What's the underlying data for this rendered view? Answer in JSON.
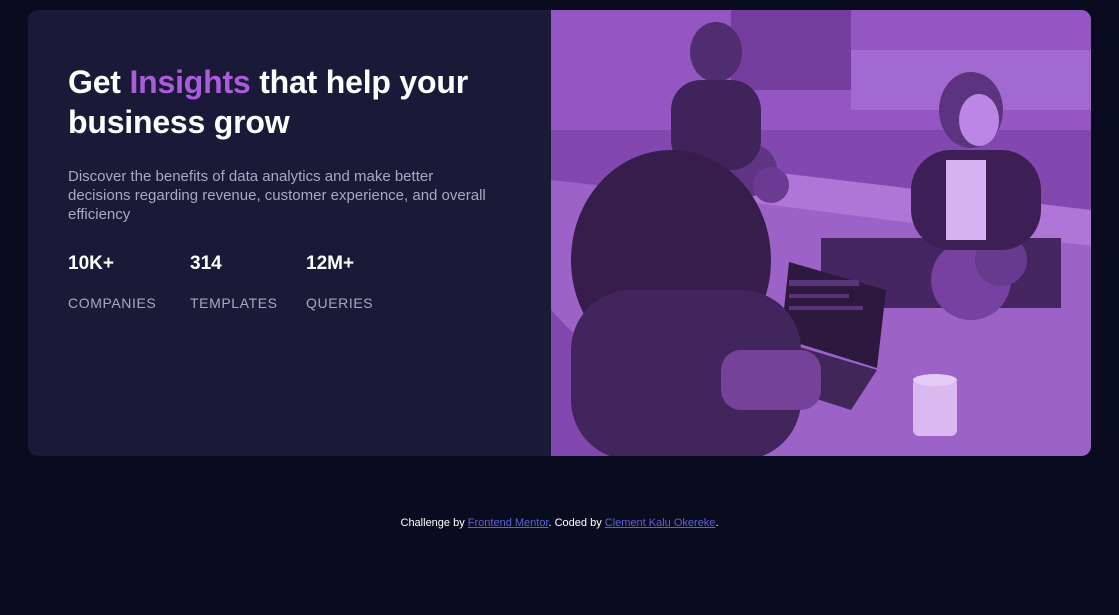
{
  "hero": {
    "headline_prefix": "Get ",
    "headline_accent": "Insights",
    "headline_suffix": " that help your business grow",
    "description": "Discover the benefits of data analytics and make better decisions regarding revenue, customer experience, and overall efficiency"
  },
  "stats": [
    {
      "value": "10K+",
      "label": "COMPANIES"
    },
    {
      "value": "314",
      "label": "TEMPLATES"
    },
    {
      "value": "12M+",
      "label": "QUERIES"
    }
  ],
  "footer": {
    "prefix": "Challenge by ",
    "link1": "Frontend Mentor",
    "middle": ". Coded by ",
    "link2": "Clement Kalu Okereke",
    "suffix": "."
  },
  "colors": {
    "page_background": "#090c1f",
    "card_background": "#1b1938",
    "accent": "#ab5cdb",
    "muted_text": "#a9a8be",
    "link": "#5a62d6"
  }
}
